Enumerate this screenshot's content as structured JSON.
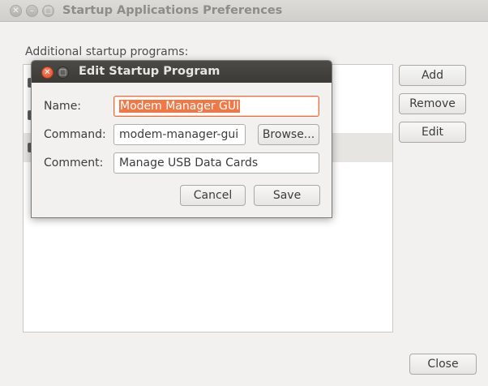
{
  "main_window": {
    "title": "Startup Applications Preferences",
    "section_label": "Additional startup programs:",
    "buttons": {
      "add": "Add",
      "remove": "Remove",
      "edit": "Edit",
      "close": "Close"
    }
  },
  "dialog": {
    "title": "Edit Startup Program",
    "fields": {
      "name_label": "Name:",
      "name_value": "Modem Manager GUI",
      "command_label": "Command:",
      "command_value": "modem-manager-gui",
      "comment_label": "Comment:",
      "comment_value": "Manage USB Data Cards"
    },
    "buttons": {
      "browse": "Browse...",
      "cancel": "Cancel",
      "save": "Save"
    }
  },
  "icons": {
    "main_close": "close-icon",
    "main_minimize": "minimize-icon",
    "main_maximize": "maximize-icon",
    "dialog_close": "close-icon",
    "dialog_maximize": "maximize-icon"
  },
  "colors": {
    "selection": "#f07746",
    "dialog_titlebar": "#3b3a37",
    "close_button": "#e0481f"
  }
}
